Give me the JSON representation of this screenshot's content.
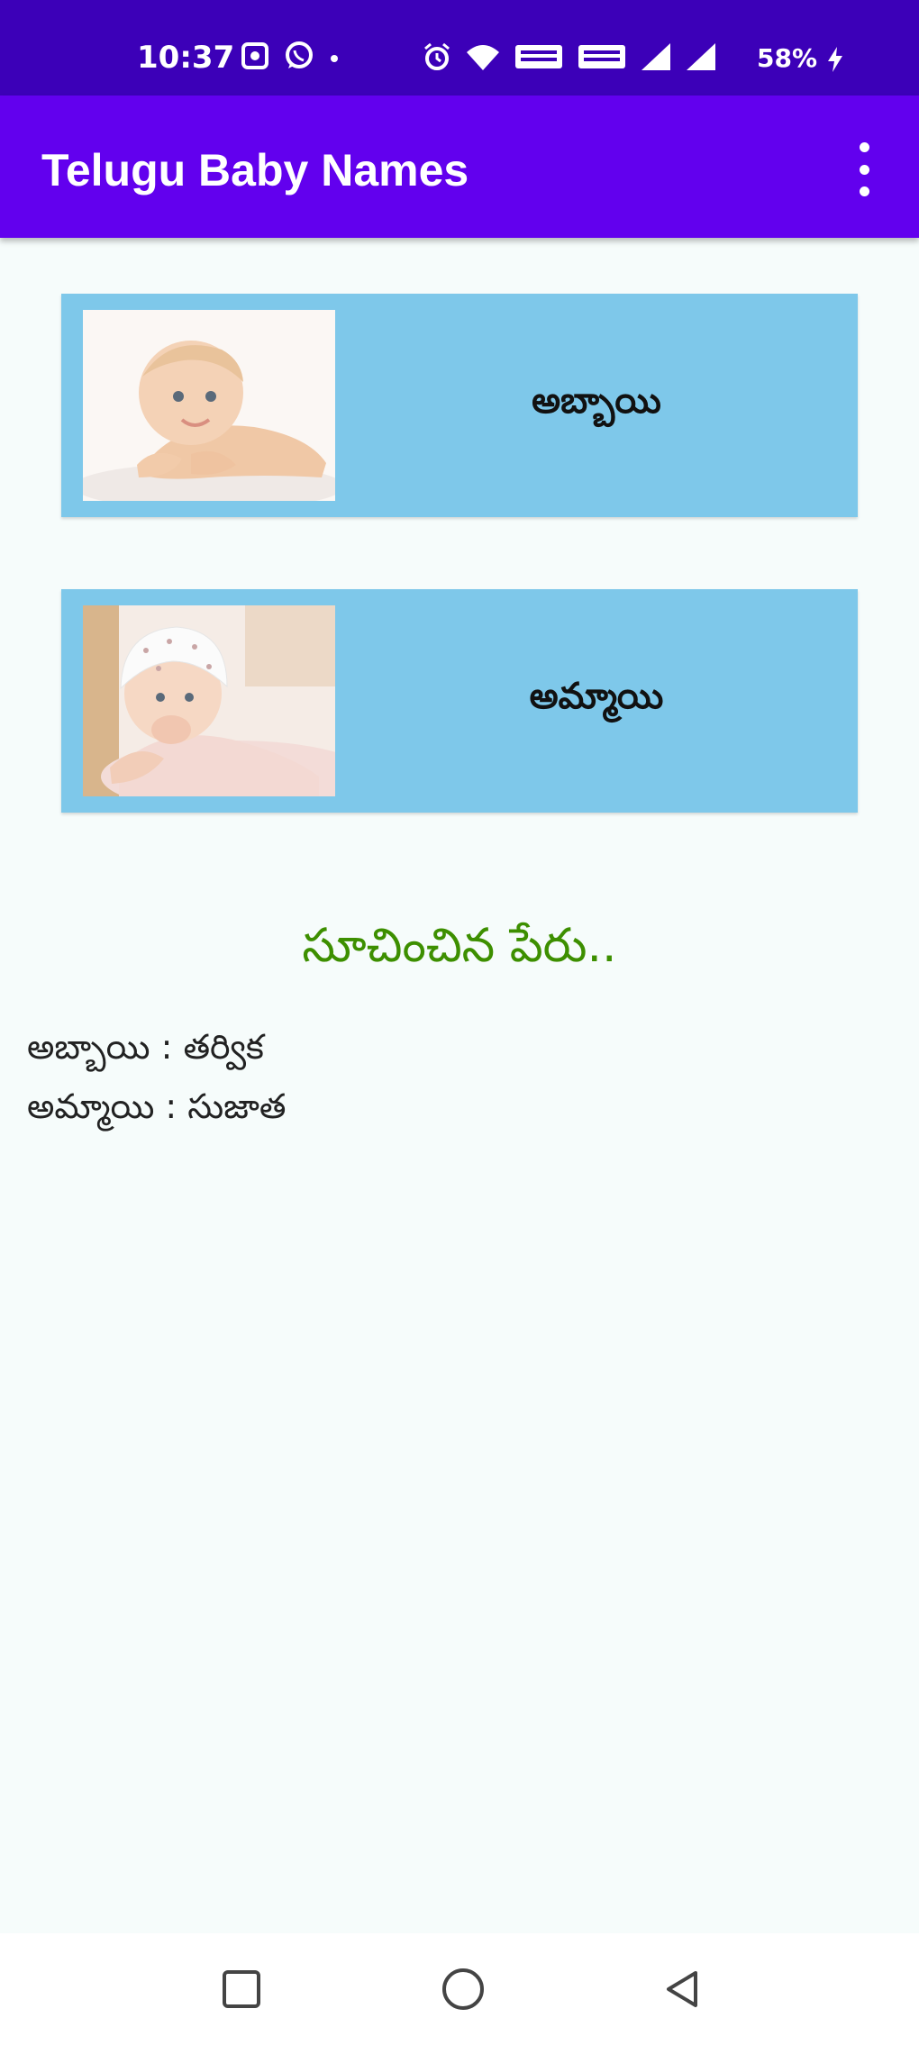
{
  "status_bar": {
    "time": "10:37",
    "battery": "58%",
    "icons": [
      "photo-icon",
      "whatsapp-icon",
      "dot-icon",
      "alarm-icon",
      "wifi-icon",
      "volte1-icon",
      "volte2-icon",
      "signal1-icon",
      "signal2-icon",
      "charging-icon"
    ]
  },
  "app_bar": {
    "title": "Telugu Baby Names"
  },
  "cards": {
    "boy_label": "అబ్బాయి",
    "girl_label": "అమ్మాయి"
  },
  "suggested": {
    "title": "సూచించిన పేరు..",
    "boy_line": "అబ్బాయి  :  తర్విక",
    "girl_line": "అమ్మాయి : సుజాత"
  },
  "nav_bar": {
    "icons": [
      "recents-icon",
      "home-icon",
      "back-icon"
    ]
  },
  "colors": {
    "status_bar": "#3c00b8",
    "app_bar": "#6200ee",
    "card": "#7ec8ea",
    "suggest_title": "#3d8f00",
    "background": "#f6fcfb"
  }
}
